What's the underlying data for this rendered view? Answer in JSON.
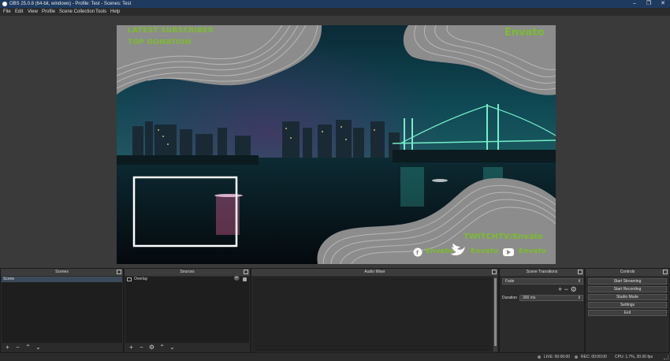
{
  "window": {
    "title": "OBS 25.0.8 (64-bit, windows) - Profile: Test - Scenes: Test",
    "minimize": "–",
    "maximize": "❐",
    "close": "✕"
  },
  "menu": [
    "File",
    "Edit",
    "View",
    "Profile",
    "Scene Collection",
    "Tools",
    "Help"
  ],
  "overlay": {
    "latest_subscriber": "LATEST SUBSCRIBER",
    "top_donation": "TOP DONATION",
    "brand": "Envato",
    "twitch": "TWITCHTV/Envato",
    "social1": "Envato",
    "social2": "Envato",
    "social3": "Envato"
  },
  "colors": {
    "accent_green": "#7dbb2f",
    "ui_dark": "#2b2b2b",
    "titlebar": "#1f3a5f"
  },
  "docks": {
    "scenes": {
      "title": "Scenes",
      "items": [
        "Scene"
      ]
    },
    "sources": {
      "title": "Sources",
      "items": [
        "Overlay"
      ]
    },
    "mixer": {
      "title": "Audio Mixer"
    },
    "transitions": {
      "title": "Scene Transitions",
      "selected": "Fade",
      "duration_label": "Duration",
      "duration_value": "300 ms"
    },
    "controls": {
      "title": "Controls",
      "buttons": [
        "Start Streaming",
        "Start Recording",
        "Studio Mode",
        "Settings",
        "Exit"
      ]
    }
  },
  "toolbar_glyphs": {
    "add": "+",
    "remove": "−",
    "up": "⌃",
    "down": "⌄",
    "gear": "⚙"
  },
  "status": {
    "live": "LIVE: 00:00:00",
    "rec": "REC: 00:00:00",
    "cpu": "CPU: 1.7%, 30.00 fps"
  }
}
